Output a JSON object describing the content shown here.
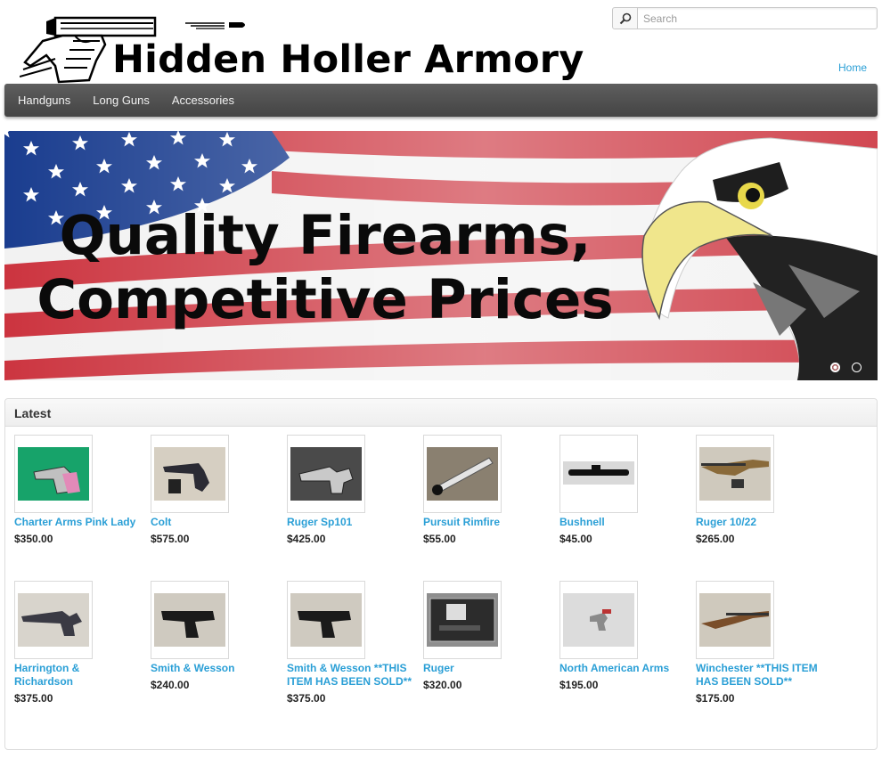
{
  "site": {
    "title": "Hidden Holler Armory",
    "home_link": "Home"
  },
  "search": {
    "placeholder": "Search"
  },
  "nav": {
    "items": [
      {
        "label": "Handguns"
      },
      {
        "label": "Long Guns"
      },
      {
        "label": "Accessories"
      }
    ]
  },
  "banner": {
    "line1": "Quality Firearms,",
    "line2": "Competitive Prices",
    "slides": 2,
    "active_slide": 1
  },
  "latest": {
    "heading": "Latest",
    "products": [
      {
        "name": "Charter Arms Pink Lady",
        "price": "$350.00",
        "icon": "revolver-pink"
      },
      {
        "name": "Colt",
        "price": "$575.00",
        "icon": "revolver-colt"
      },
      {
        "name": "Ruger Sp101",
        "price": "$425.00",
        "icon": "revolver-steel"
      },
      {
        "name": "Pursuit Rimfire",
        "price": "$55.00",
        "icon": "scope"
      },
      {
        "name": "Bushnell",
        "price": "$45.00",
        "icon": "scope-black"
      },
      {
        "name": "Ruger 10/22",
        "price": "$265.00",
        "icon": "rifle"
      },
      {
        "name": "Harrington & Richardson",
        "price": "$375.00",
        "icon": "revolver-long"
      },
      {
        "name": "Smith & Wesson",
        "price": "$240.00",
        "icon": "pistol"
      },
      {
        "name": "Smith & Wesson **THIS ITEM HAS BEEN SOLD**",
        "price": "$375.00",
        "icon": "pistol"
      },
      {
        "name": "Ruger",
        "price": "$320.00",
        "icon": "pistol-case"
      },
      {
        "name": "North American Arms",
        "price": "$195.00",
        "icon": "mini-revolver"
      },
      {
        "name": "Winchester **THIS ITEM HAS BEEN SOLD**",
        "price": "$175.00",
        "icon": "shotgun"
      }
    ]
  },
  "colors": {
    "link": "#2a9fd6",
    "nav_bg": "#4f4f4f"
  }
}
